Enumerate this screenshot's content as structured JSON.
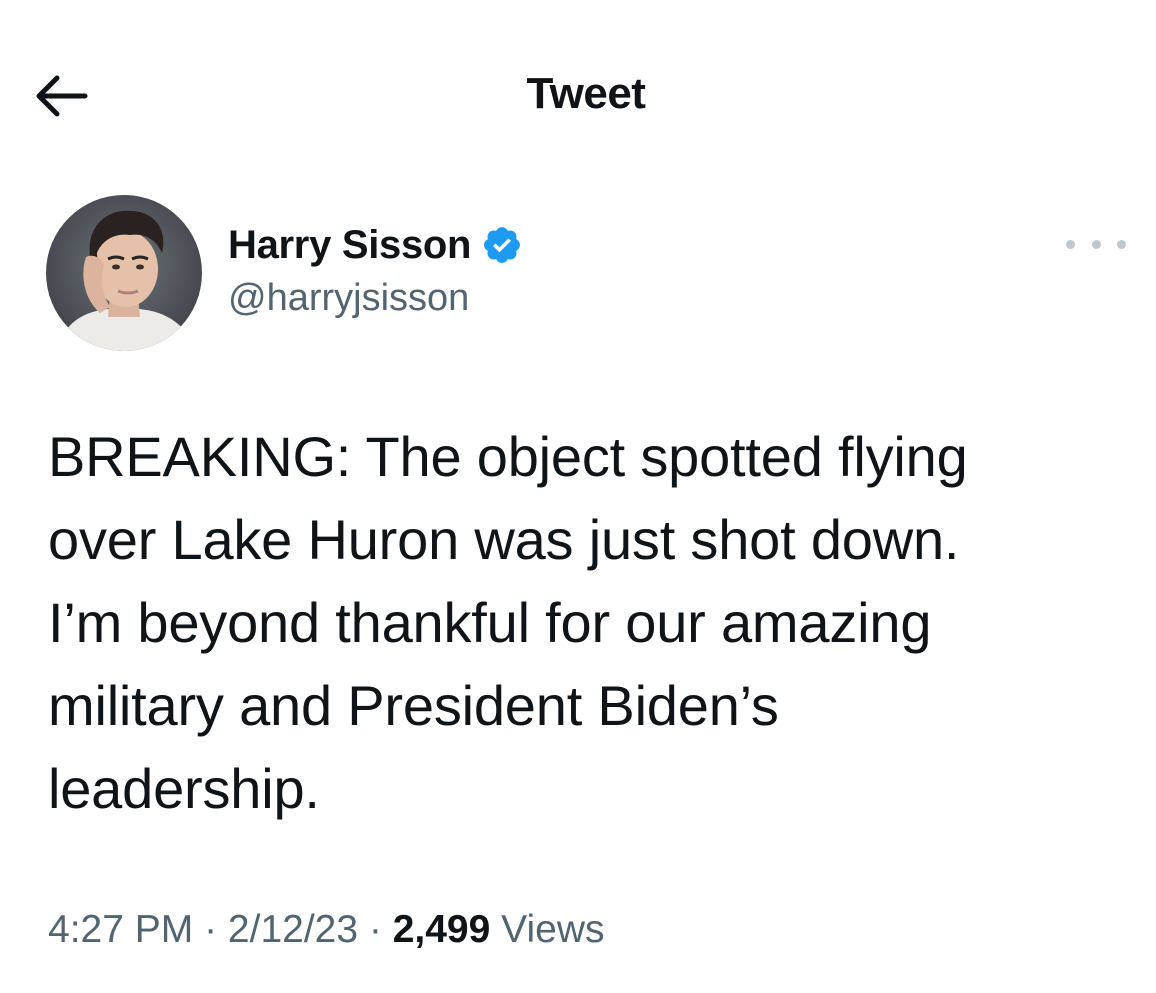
{
  "header": {
    "title": "Tweet",
    "back_icon": "arrow-left-icon"
  },
  "author": {
    "display_name": "Harry Sisson",
    "handle": "@harryjsisson",
    "verified": true,
    "verified_color": "#1d9bf0"
  },
  "more_icon": "ellipsis-icon",
  "tweet": {
    "text": "BREAKING: The object spotted flying\nover Lake Huron was just shot down.\nI’m beyond thankful for our amazing\nmilitary and President Biden’s\nleadership."
  },
  "meta": {
    "time": "4:27 PM",
    "separator": " · ",
    "date": "2/12/23",
    "views_count": "2,499",
    "views_label": "Views"
  }
}
